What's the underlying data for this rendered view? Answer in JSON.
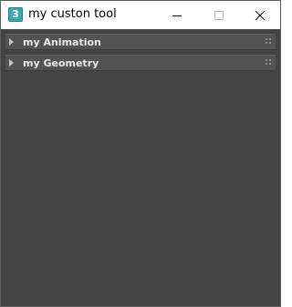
{
  "window": {
    "title": "my custon tool",
    "app_icon_glyph": "3",
    "controls": [
      "minimize-icon",
      "maximize-icon",
      "close-icon"
    ]
  },
  "rollouts": [
    {
      "label": "my Animation",
      "expanded": false
    },
    {
      "label": "my Geometry",
      "expanded": false
    }
  ],
  "colors": {
    "content_bg": "#444444",
    "rollout_bg": "#535353",
    "rollout_text": "#e8e8e8",
    "titlebar_bg": "#ffffff",
    "app_icon": "#3aa6b3"
  }
}
